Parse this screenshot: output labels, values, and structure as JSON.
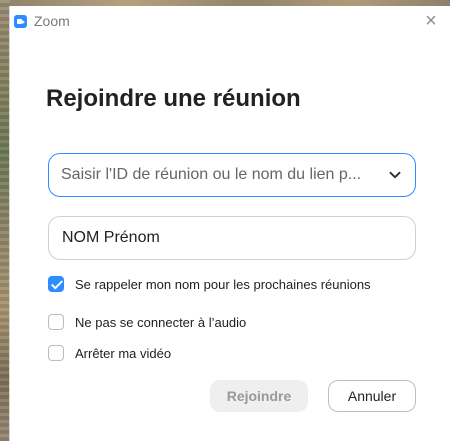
{
  "window": {
    "app_title": "Zoom",
    "app_icon": "zoom-camera-icon",
    "close_icon": "close-icon"
  },
  "dialog": {
    "title": "Rejoindre une réunion",
    "meeting_field": {
      "value": "",
      "placeholder": "Saisir l'ID de réunion ou le nom du lien p...",
      "dropdown_icon": "chevron-down-icon"
    },
    "name_field": {
      "value": "NOM Prénom"
    },
    "options": [
      {
        "label": "Se rappeler mon nom pour les prochaines réunions",
        "checked": true
      },
      {
        "label": "Ne pas se connecter à l’audio",
        "checked": false
      },
      {
        "label": "Arrêter ma vidéo",
        "checked": false
      }
    ],
    "buttons": {
      "join": "Rejoindre",
      "cancel": "Annuler"
    }
  },
  "colors": {
    "accent": "#2d8cff",
    "disabled_text": "#999999"
  }
}
